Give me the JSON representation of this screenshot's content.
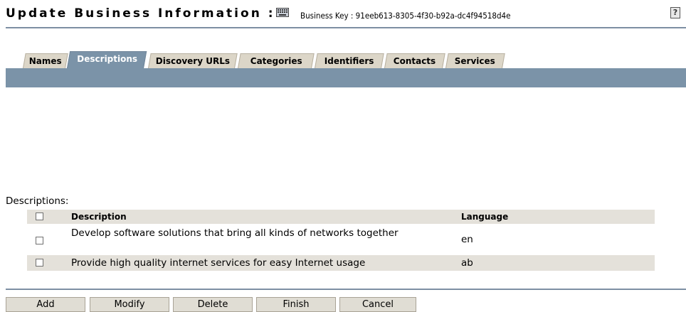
{
  "header": {
    "title": "Update Business Information :",
    "business_key_label": "Business Key : 91eeb613-8305-4f30-b92a-dc4f94518d4e",
    "help_icon_text": "?"
  },
  "tabs": [
    {
      "label": "Names",
      "active": false
    },
    {
      "label": "Descriptions",
      "active": true
    },
    {
      "label": "Discovery URLs",
      "active": false
    },
    {
      "label": "Categories",
      "active": false
    },
    {
      "label": "Identifiers",
      "active": false
    },
    {
      "label": "Contacts",
      "active": false
    },
    {
      "label": "Services",
      "active": false
    }
  ],
  "descriptions": {
    "caption": "Descriptions:",
    "columns": {
      "description": "Description",
      "language": "Language"
    },
    "rows": [
      {
        "description": "Develop software solutions that bring all kinds of networks together",
        "language": "en",
        "checked": false
      },
      {
        "description": "Provide high quality internet services for easy Internet usage",
        "language": "ab",
        "checked": false
      }
    ]
  },
  "buttons": {
    "add": "Add",
    "modify": "Modify",
    "delete": "Delete",
    "finish": "Finish",
    "cancel": "Cancel"
  },
  "colors": {
    "band": "#7b93a8",
    "tab_inactive": "#dcd6c8",
    "row_alt": "#e4e1da",
    "button": "#e0ddd4"
  }
}
